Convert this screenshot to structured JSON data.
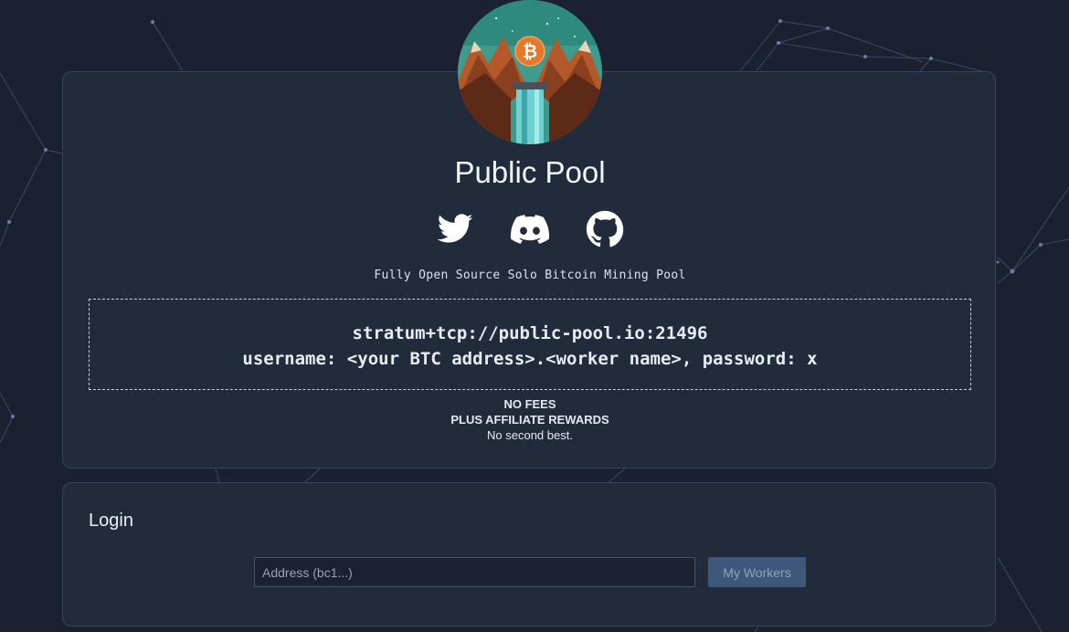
{
  "app": {
    "title": "Public Pool",
    "tagline": "Fully Open Source Solo Bitcoin Mining Pool"
  },
  "social": {
    "twitter": "twitter-icon",
    "discord": "discord-icon",
    "github": "github-icon"
  },
  "stratum": {
    "url": "stratum+tcp://public-pool.io:21496",
    "credentials": "username: <your BTC address>.<worker name>, password: x"
  },
  "fees": {
    "line1": "NO FEES",
    "line2": "PLUS AFFILIATE REWARDS",
    "line3": "No second best."
  },
  "login": {
    "title": "Login",
    "address_placeholder": "Address (bc1...)",
    "address_value": "",
    "button_label": "My Workers"
  },
  "colors": {
    "background": "#1b2130",
    "card": "#222b3c",
    "accent_button": "#3d5878",
    "bitcoin_orange": "#e8772e"
  }
}
